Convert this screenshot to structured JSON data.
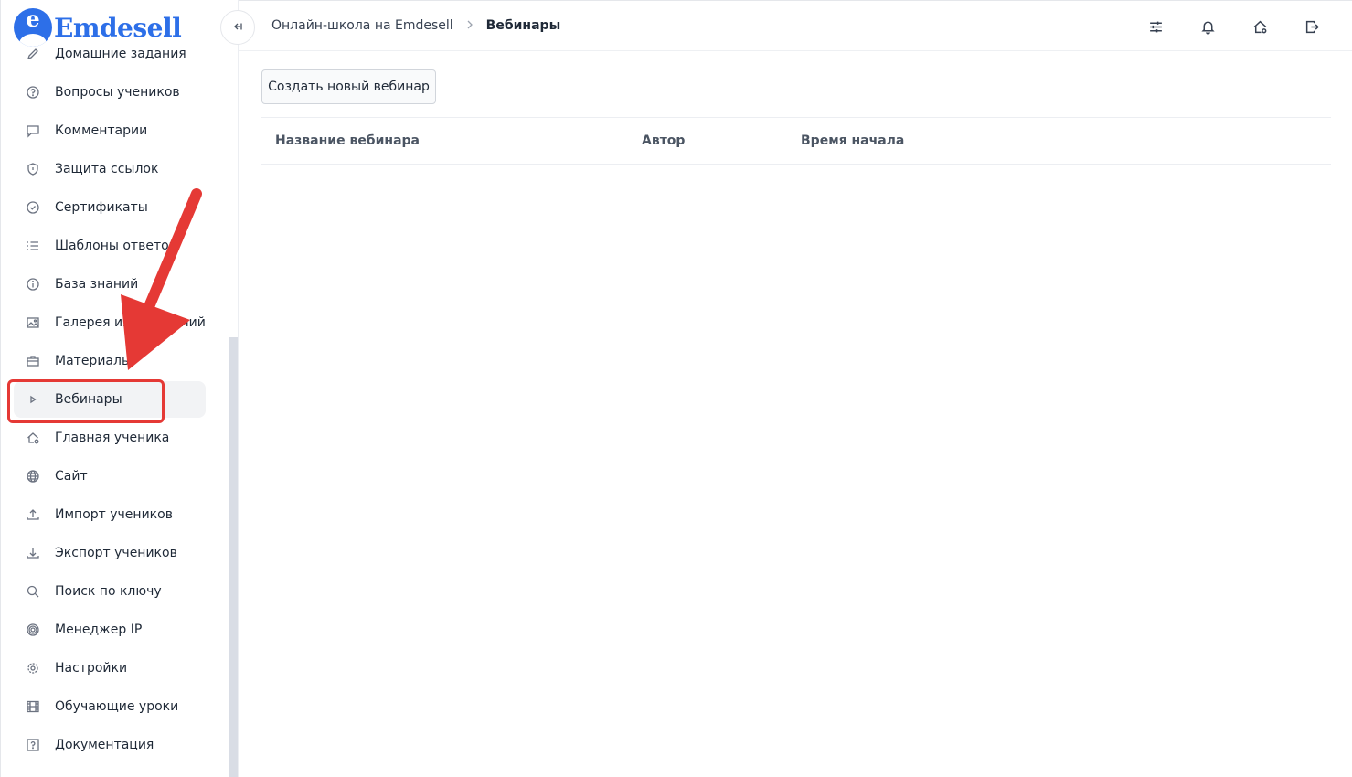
{
  "brand": {
    "logo_letter": "e",
    "name": "Emdesell",
    "color": "#2d6fe8"
  },
  "sidebar": {
    "items": [
      {
        "label": "Домашние задания",
        "icon": "pencil-icon"
      },
      {
        "label": "Вопросы учеников",
        "icon": "question-circle-icon"
      },
      {
        "label": "Комментарии",
        "icon": "comment-icon"
      },
      {
        "label": "Защита ссылок",
        "icon": "shield-icon"
      },
      {
        "label": "Сертификаты",
        "icon": "check-circle-icon"
      },
      {
        "label": "Шаблоны ответов",
        "icon": "list-icon"
      },
      {
        "label": "База знаний",
        "icon": "info-circle-icon"
      },
      {
        "label": "Галерея изображений",
        "icon": "image-icon"
      },
      {
        "label": "Материалы",
        "icon": "briefcase-icon"
      },
      {
        "label": "Вебинары",
        "icon": "play-icon"
      },
      {
        "label": "Главная ученика",
        "icon": "home-gear-icon"
      },
      {
        "label": "Сайт",
        "icon": "globe-icon"
      },
      {
        "label": "Импорт учеников",
        "icon": "upload-icon"
      },
      {
        "label": "Экспорт учеников",
        "icon": "download-icon"
      },
      {
        "label": "Поиск по ключу",
        "icon": "search-icon"
      },
      {
        "label": "Менеджер IP",
        "icon": "target-icon"
      },
      {
        "label": "Настройки",
        "icon": "gear-icon"
      },
      {
        "label": "Обучающие уроки",
        "icon": "film-icon"
      },
      {
        "label": "Документация",
        "icon": "help-square-icon"
      }
    ],
    "active_label": "Вебинары",
    "collapse_icon": "collapse-left-icon"
  },
  "header": {
    "breadcrumb_parent": "Онлайн-школа на Emdesell",
    "breadcrumb_current": "Вебинары",
    "icons": [
      "sliders-icon",
      "bell-icon",
      "home-gear-icon",
      "logout-icon"
    ]
  },
  "main": {
    "create_button": "Создать новый вебинар",
    "table_headers": [
      "Название вебинара",
      "Автор",
      "Время начала"
    ]
  },
  "annotation": {
    "color": "#e53935"
  }
}
